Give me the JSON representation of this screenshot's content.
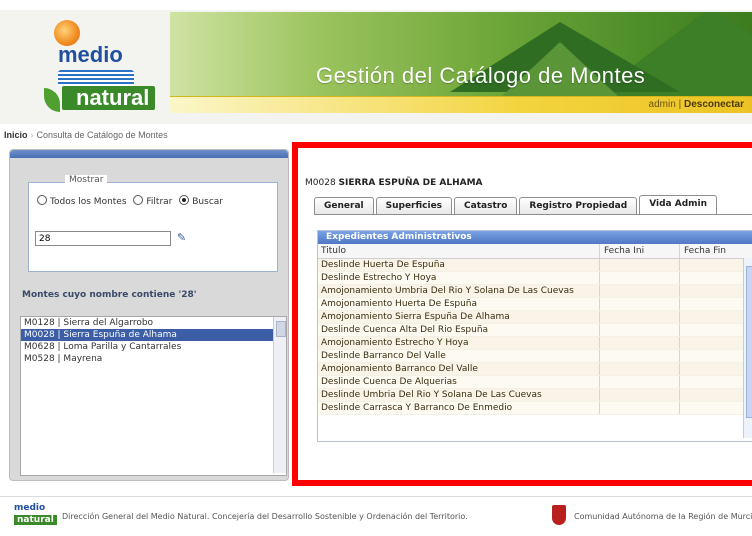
{
  "header": {
    "logo_line1": "medio",
    "logo_line2": "natural",
    "app_title": "Gestión del Catálogo de Montes",
    "user": "admin",
    "separator": "|",
    "logout": "Desconectar"
  },
  "breadcrumb": {
    "home": "Inicio",
    "separator": "›",
    "current": "Consulta de Catálogo de Montes"
  },
  "filter": {
    "legend": "Mostrar",
    "options": [
      "Todos los Montes",
      "Filtrar",
      "Buscar"
    ],
    "selected": "Buscar",
    "search_value": "28"
  },
  "results": {
    "title": "Montes cuyo nombre contiene '28'",
    "items": [
      {
        "label": "M0128 | Sierra del Algarrobo",
        "selected": false
      },
      {
        "label": "M0028 | Sierra Espuña de Alhama",
        "selected": true
      },
      {
        "label": "M0628 | Loma Parilla y Cantarrales",
        "selected": false
      },
      {
        "label": "M0528 | Mayrena",
        "selected": false
      }
    ]
  },
  "detail": {
    "code": "M0028",
    "name": "SIERRA ESPUÑA DE ALHAMA",
    "tabs": [
      "General",
      "Superficies",
      "Catastro",
      "Registro Propiedad",
      "Vida Admin"
    ],
    "active_tab": "Vida Admin",
    "grid": {
      "caption": "Expedientes Administrativos",
      "columns": [
        "Titulo",
        "Fecha Ini",
        "Fecha Fin"
      ],
      "rows": [
        "Deslinde Huerta De Espuña",
        "Deslinde Estrecho Y Hoya",
        "Amojonamiento Umbria Del Rio Y Solana De Las Cuevas",
        "Amojonamiento Huerta De Espuña",
        "Amojonamiento Sierra Espuña De Alhama",
        "Deslinde Cuenca Alta Del Rio Espuña",
        "Amojonamiento Estrecho Y Hoya",
        "Deslinde Barranco Del Valle",
        "Amojonamiento Barranco Del Valle",
        "Deslinde Cuenca De Alquerias",
        "Deslinde Umbria Del Rio Y Solana De Las Cuevas",
        "Deslinde Carrasca Y Barranco De Enmedio"
      ]
    }
  },
  "footer": {
    "logo_line1": "medio",
    "logo_line2": "natural",
    "left_text": "Dirección General del Medio Natural. Concejería del Desarrollo Sostenible y Ordenación del Territorio.",
    "right_text": "Comunidad Autónoma de la Región de Murcia"
  },
  "colors": {
    "highlight": "#ff0000",
    "accent_blue": "#3b5ea6",
    "banner_green": "#4f8f2a",
    "userbar_yellow": "#f3d43f"
  }
}
